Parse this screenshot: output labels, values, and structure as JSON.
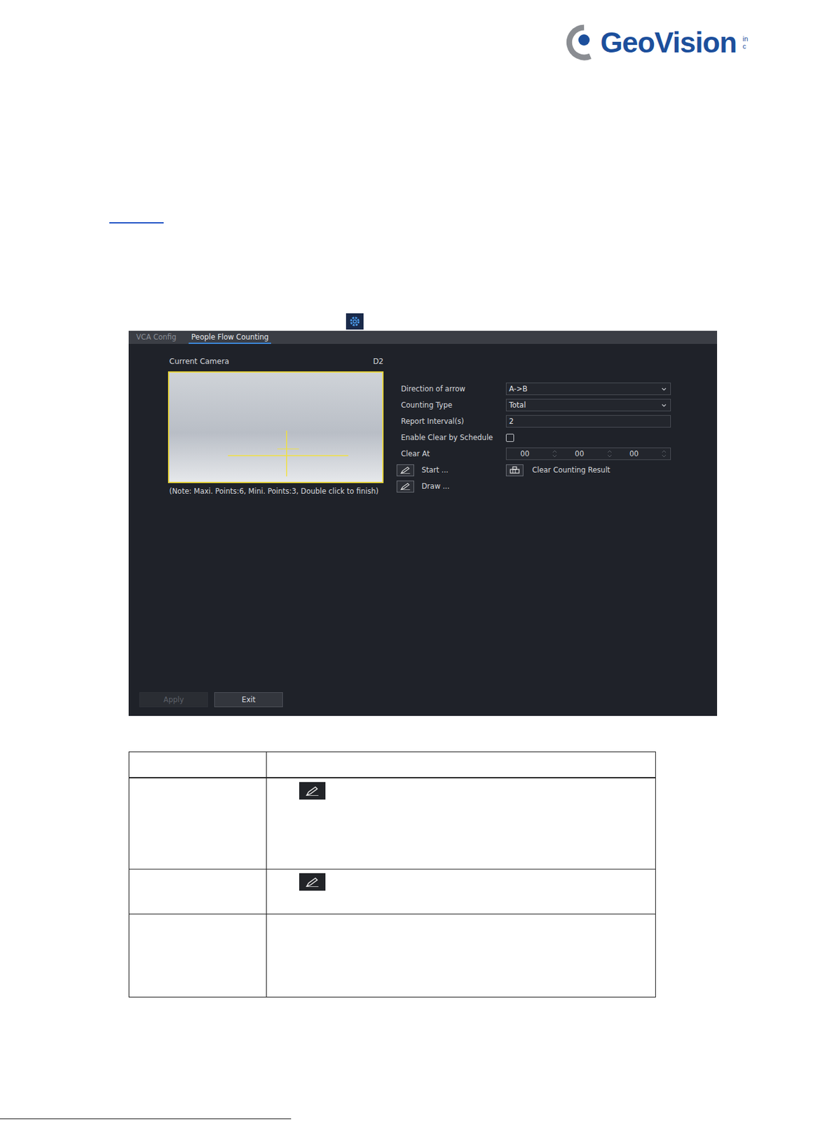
{
  "logo": {
    "name": "GeoVision",
    "suffix": "inc"
  },
  "tabs": [
    {
      "label": "VCA Config",
      "selected": false
    },
    {
      "label": "People Flow Counting",
      "selected": true
    }
  ],
  "camera": {
    "label": "Current Camera",
    "value": "D2"
  },
  "note": "(Note: Maxi. Points:6, Mini. Points:3, Double click to finish)",
  "fields": [
    {
      "label": "Direction of arrow",
      "kind": "select",
      "value": "A->B"
    },
    {
      "label": "Counting Type",
      "kind": "select",
      "value": "Total"
    },
    {
      "label": "Report Interval(s)",
      "kind": "text",
      "value": "2"
    },
    {
      "label": "Enable Clear by Schedule",
      "kind": "checkbox",
      "checked": false
    },
    {
      "label": "Clear At",
      "kind": "time",
      "values": [
        "00",
        "00",
        "00"
      ]
    }
  ],
  "actions": [
    {
      "label": "Start ...",
      "extra": "Clear Counting Result"
    },
    {
      "label": "Draw ...",
      "extra": ""
    }
  ],
  "buttons": [
    {
      "label": "Apply",
      "disabled": true
    },
    {
      "label": "Exit",
      "disabled": false
    }
  ],
  "table": {
    "rows": [
      {
        "icon": true,
        "height": "tall"
      },
      {
        "icon": true,
        "height": "short"
      },
      {
        "icon": false,
        "height": "mid"
      }
    ]
  }
}
